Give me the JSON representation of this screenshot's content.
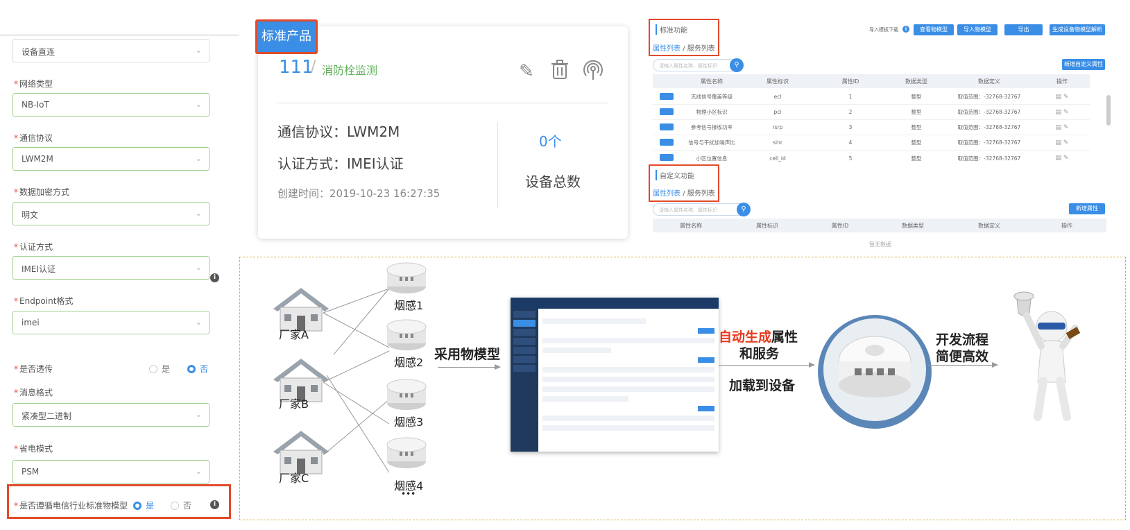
{
  "form": {
    "field0": {
      "value": "设备直连"
    },
    "network": {
      "label": "网络类型",
      "value": "NB-IoT"
    },
    "protocol": {
      "label": "通信协议",
      "value": "LWM2M"
    },
    "encryption": {
      "label": "数据加密方式",
      "value": "明文"
    },
    "auth": {
      "label": "认证方式",
      "value": "IMEI认证"
    },
    "endpoint": {
      "label": "Endpoint格式",
      "value": "imei"
    },
    "passthrough": {
      "label": "是否透传",
      "yes": "是",
      "no": "否",
      "selected": "否"
    },
    "msgformat": {
      "label": "消息格式",
      "value": "紧凑型二进制"
    },
    "power": {
      "label": "省电模式",
      "value": "PSM"
    },
    "standard": {
      "label": "是否遵循电信行业标准物模型",
      "yes": "是",
      "no": "否",
      "selected": "是"
    }
  },
  "card": {
    "badge": "标准产品",
    "product_id": "111",
    "slash": "/",
    "product_name": "消防栓监测",
    "protocol_line": "通信协议：LWM2M",
    "auth_line": "认证方式：IMEI认证",
    "created_line": "创建时间：2019-10-23 16:27:35",
    "device_count": "0个",
    "device_count_label": "设备总数"
  },
  "tables": {
    "std_title": "标准功能",
    "std_tab_attrs": "属性列表",
    "std_tab_sep": " / ",
    "std_tab_services": "服务列表",
    "toolbar": {
      "import_label": "导入模板下载",
      "btn1": "查看物模型",
      "btn2": "导入物模型",
      "btn3": "导出",
      "btn4": "生成设备物模型解析"
    },
    "search_placeholder": "请输入属性名称、属性标识",
    "add_attr_btn": "新增自定义属性",
    "columns": [
      "属性名称",
      "属性标识",
      "属性ID",
      "数据类型",
      "数据定义",
      "操作"
    ],
    "rows": [
      {
        "name": "无线信号覆盖等级",
        "ident": "ecl",
        "id": "1",
        "type": "整型",
        "def": "取值范围：-32768-32767"
      },
      {
        "name": "物理小区标识",
        "ident": "pci",
        "id": "2",
        "type": "整型",
        "def": "取值范围：-32768-32767"
      },
      {
        "name": "参考信号接收功率",
        "ident": "rsrp",
        "id": "3",
        "type": "整型",
        "def": "取值范围：-32768-32767"
      },
      {
        "name": "信号与干扰加噪声比",
        "ident": "sinr",
        "id": "4",
        "type": "整型",
        "def": "取值范围：-32768-32767"
      },
      {
        "name": "小区位置信息",
        "ident": "cell_id",
        "id": "5",
        "type": "整型",
        "def": "取值范围：-32768-32767"
      }
    ],
    "custom_title": "自定义功能",
    "custom_tab_attrs": "属性列表",
    "custom_tab_services": "服务列表",
    "custom_search_placeholder": "请输入属性名称、属性标识",
    "custom_add_btn": "新增属性",
    "custom_columns": [
      "属性名称",
      "属性标识",
      "属性ID",
      "数据类型",
      "数据定义",
      "操作"
    ],
    "no_data": "暂无数据"
  },
  "diagram": {
    "houses": [
      "厂家A",
      "厂家B",
      "厂家C"
    ],
    "sensors": [
      "烟感1",
      "烟感2",
      "烟感3",
      "烟感4"
    ],
    "ellipsis": "•••",
    "model_text": "采用物模型",
    "auto_gen_red": "自动生成",
    "auto_gen_rest": "属性",
    "and_services": "和服务",
    "load_text": "加载到设备",
    "dev_text_1": "开发流程",
    "dev_text_2": "简便高效",
    "colors": {
      "accent": "#3a8ee6",
      "highlight": "#e24a2a",
      "red_text": "#e8391f"
    }
  }
}
